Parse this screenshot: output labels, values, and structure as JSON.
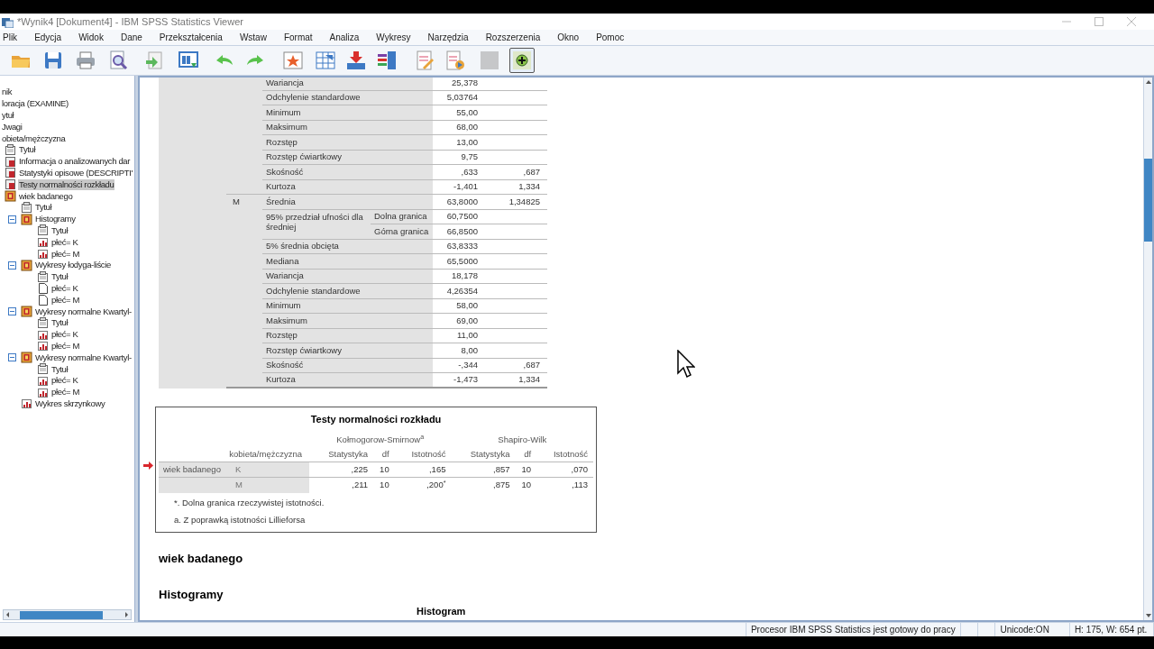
{
  "window": {
    "title": "*Wynik4 [Dokument4] - IBM SPSS Statistics Viewer"
  },
  "menu": [
    "Plik",
    "Edycja",
    "Widok",
    "Dane",
    "Przekształcenia",
    "Wstaw",
    "Format",
    "Analiza",
    "Wykresy",
    "Narzędzia",
    "Rozszerzenia",
    "Okno",
    "Pomoc"
  ],
  "toolbar": [
    {
      "disabled": false,
      "selected": false
    },
    {
      "disabled": false,
      "selected": false
    },
    {
      "disabled": false,
      "selected": false
    },
    {
      "disabled": false,
      "selected": false
    },
    {
      "disabled": false,
      "selected": false
    },
    {
      "disabled": false,
      "selected": false
    },
    {
      "disabled": false,
      "selected": false
    },
    {
      "disabled": false,
      "selected": false
    },
    {
      "disabled": false,
      "selected": false
    },
    {
      "disabled": false,
      "selected": false
    },
    {
      "disabled": false,
      "selected": false
    },
    {
      "disabled": false,
      "selected": false
    },
    {
      "disabled": false,
      "selected": false
    },
    {
      "disabled": false,
      "selected": false
    },
    {
      "disabled": true,
      "selected": false
    },
    {
      "disabled": false,
      "selected": true
    }
  ],
  "outline": [
    {
      "label": "nik",
      "kind": "cut",
      "selected": false
    },
    {
      "label": "loracja (EXAMINE)",
      "kind": "cut",
      "selected": false
    },
    {
      "label": "ytuł",
      "kind": "cut",
      "selected": false
    },
    {
      "label": "Jwagi",
      "kind": "cut",
      "selected": false
    },
    {
      "label": "obieta/mężczyzna",
      "kind": "cut",
      "selected": false
    },
    {
      "label": "Tytuł",
      "kind": "title",
      "selected": false
    },
    {
      "label": "Informacja o analizowanych dar",
      "kind": "table",
      "selected": false
    },
    {
      "label": "Statystyki opisowe (DESCRIPTI'",
      "kind": "table",
      "selected": false
    },
    {
      "label": "Testy normalności rozkładu",
      "kind": "table",
      "selected": true
    },
    {
      "label": "wiek badanego",
      "kind": "folder",
      "selected": false,
      "children": [
        {
          "label": "Tytuł",
          "kind": "title",
          "selected": false
        },
        {
          "label": "Histogramy",
          "kind": "folder",
          "selected": false,
          "expanded": true,
          "children": [
            {
              "label": "Tytuł",
              "kind": "title",
              "selected": false
            },
            {
              "label": "płeć= K",
              "kind": "chart",
              "selected": false
            },
            {
              "label": "płeć= M",
              "kind": "chart",
              "selected": false
            }
          ]
        },
        {
          "label": "Wykresy łodyga-liście",
          "kind": "folder",
          "selected": false,
          "expanded": true,
          "children": [
            {
              "label": "Tytuł",
              "kind": "title",
              "selected": false
            },
            {
              "label": "płeć= K",
              "kind": "text",
              "selected": false
            },
            {
              "label": "płeć= M",
              "kind": "text",
              "selected": false
            }
          ]
        },
        {
          "label": "Wykresy normalne Kwartyl-",
          "kind": "folder",
          "selected": false,
          "expanded": true,
          "children": [
            {
              "label": "Tytuł",
              "kind": "title",
              "selected": false
            },
            {
              "label": "płeć= K",
              "kind": "chart",
              "selected": false
            },
            {
              "label": "płeć= M",
              "kind": "chart",
              "selected": false
            }
          ]
        },
        {
          "label": "Wykresy normalne Kwartyl-",
          "kind": "folder",
          "selected": false,
          "expanded": true,
          "children": [
            {
              "label": "Tytuł",
              "kind": "title",
              "selected": false
            },
            {
              "label": "płeć= K",
              "kind": "chart",
              "selected": false
            },
            {
              "label": "płeć= M",
              "kind": "chart",
              "selected": false
            }
          ]
        },
        {
          "label": "Wykres skrzynkowy",
          "kind": "chart",
          "selected": false
        }
      ]
    }
  ],
  "descriptives": {
    "rows": [
      {
        "label": "Wariancja",
        "stat": "25,378"
      },
      {
        "label": "Odchylenie standardowe",
        "stat": "5,03764"
      },
      {
        "label": "Minimum",
        "stat": "55,00"
      },
      {
        "label": "Maksimum",
        "stat": "68,00"
      },
      {
        "label": "Rozstęp",
        "stat": "13,00"
      },
      {
        "label": "Rozstęp ćwiartkowy",
        "stat": "9,75"
      },
      {
        "label": "Skośność",
        "stat": ",633",
        "se": ",687"
      },
      {
        "label": "Kurtoza",
        "stat": "-1,401",
        "se": "1,334"
      },
      {
        "group": "M",
        "label": "Średnia",
        "stat": "63,8000",
        "se": "1,34825"
      },
      {
        "kind": "ci",
        "label": "95% przedział ufności dla średniej",
        "bounds": [
          {
            "sub": "Dolna granica",
            "stat": "60,7500"
          },
          {
            "sub": "Górna granica",
            "stat": "66,8500"
          }
        ]
      },
      {
        "label": "5% średnia obcięta",
        "stat": "63,8333"
      },
      {
        "label": "Mediana",
        "stat": "65,5000"
      },
      {
        "label": "Wariancja",
        "stat": "18,178"
      },
      {
        "label": "Odchylenie standardowe",
        "stat": "4,26354"
      },
      {
        "label": "Minimum",
        "stat": "58,00"
      },
      {
        "label": "Maksimum",
        "stat": "69,00"
      },
      {
        "label": "Rozstęp",
        "stat": "11,00"
      },
      {
        "label": "Rozstęp ćwiartkowy",
        "stat": "8,00"
      },
      {
        "label": "Skośność",
        "stat": "-,344",
        "se": ",687"
      },
      {
        "label": "Kurtoza",
        "stat": "-1,473",
        "se": "1,334"
      }
    ]
  },
  "normality": {
    "title": "Testy normalności rozkładu",
    "groups": [
      "Kołmogorow-Smirnow$^{a}$",
      "Shapiro-Wilk"
    ],
    "row_header": "kobieta/mężczyzna",
    "columns": [
      "Statystyka",
      "df",
      "Istotność",
      "Statystyka",
      "df",
      "Istotność"
    ],
    "variable": "wiek badanego",
    "rows": [
      {
        "group": "K",
        "cells": [
          ",225",
          "10",
          ",165",
          ",857",
          "10",
          ",070"
        ]
      },
      {
        "group": "M",
        "cells": [
          ",211",
          "10",
          ",200$^{*}$",
          ",875",
          "10",
          ",113"
        ]
      }
    ],
    "footnotes": [
      "*. Dolna granica rzeczywistej istotności.",
      "a. Z poprawką istotności Lillieforsa"
    ]
  },
  "headings": [
    "wiek badanego",
    "Histogramy"
  ],
  "chart_title": "Histogram",
  "status_bar": [
    "Procesor IBM SPSS Statistics  jest gotowy do pracy",
    "Unicode:ON",
    "H: 175, W: 654 pt."
  ]
}
